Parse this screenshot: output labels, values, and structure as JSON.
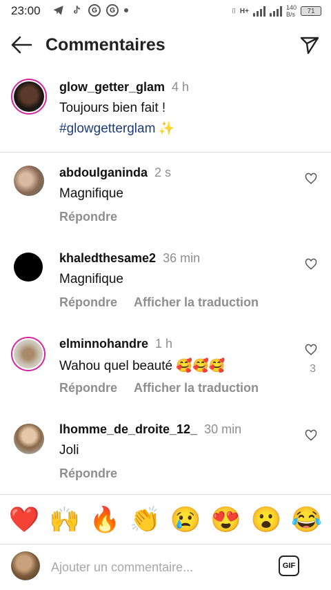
{
  "status_bar": {
    "time": "23:00",
    "network": "H+",
    "speed": "140\nB/s",
    "battery": "71"
  },
  "header": {
    "title": "Commentaires"
  },
  "caption": {
    "username": "glow_getter_glam",
    "time": "4 h",
    "text": "Toujours bien fait !",
    "hashtag": "#glowgetterglam",
    "sparkle": "✨"
  },
  "comments": [
    {
      "username": "abdoulganinda",
      "time": "2 s",
      "text": "Magnifique",
      "reply": "Répondre",
      "translate": "",
      "likes": ""
    },
    {
      "username": "khaledthesame2",
      "time": "36 min",
      "text": "Magnifique",
      "reply": "Répondre",
      "translate": "Afficher la traduction",
      "likes": ""
    },
    {
      "username": "elminnohandre",
      "time": "1 h",
      "text": "Wahou quel beauté 🥰🥰🥰",
      "reply": "Répondre",
      "translate": "Afficher la traduction",
      "likes": "3"
    },
    {
      "username": "lhomme_de_droite_12_",
      "time": "30 min",
      "text": "Joli",
      "reply": "Répondre",
      "translate": "",
      "likes": ""
    }
  ],
  "emoji_reactions": [
    "❤️",
    "🙌",
    "🔥",
    "👏",
    "😢",
    "😍",
    "😮",
    "😂"
  ],
  "composer": {
    "placeholder": "Ajouter un commentaire...",
    "gif_label": "GIF"
  },
  "icons": {
    "back": "arrow-left-icon",
    "send": "paper-plane-icon",
    "like": "heart-outline-icon"
  },
  "colors": {
    "story_ring": "#d6249f",
    "hashtag": "#1d3b7a",
    "muted": "#8e8e8e"
  }
}
